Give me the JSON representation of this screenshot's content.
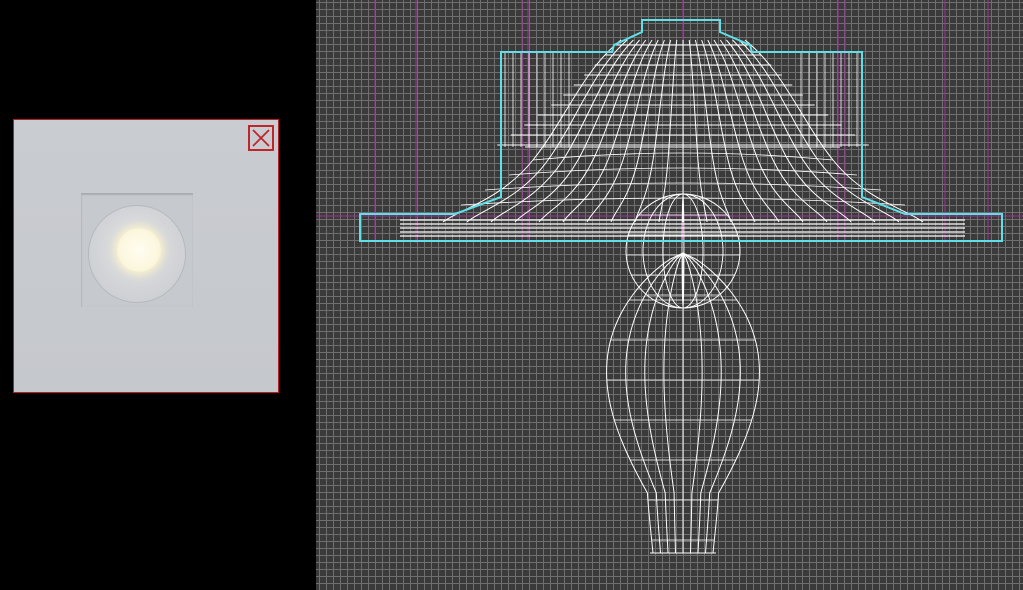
{
  "colors": {
    "viewport_bg": "#3a3a3a",
    "grid": "#6f6f6f",
    "wireframe": "#ffffff",
    "selection": "#5fe0e8",
    "guide": "#a0309a",
    "preview_border": "#d01c24"
  },
  "icons": {
    "close": "close-icon"
  }
}
